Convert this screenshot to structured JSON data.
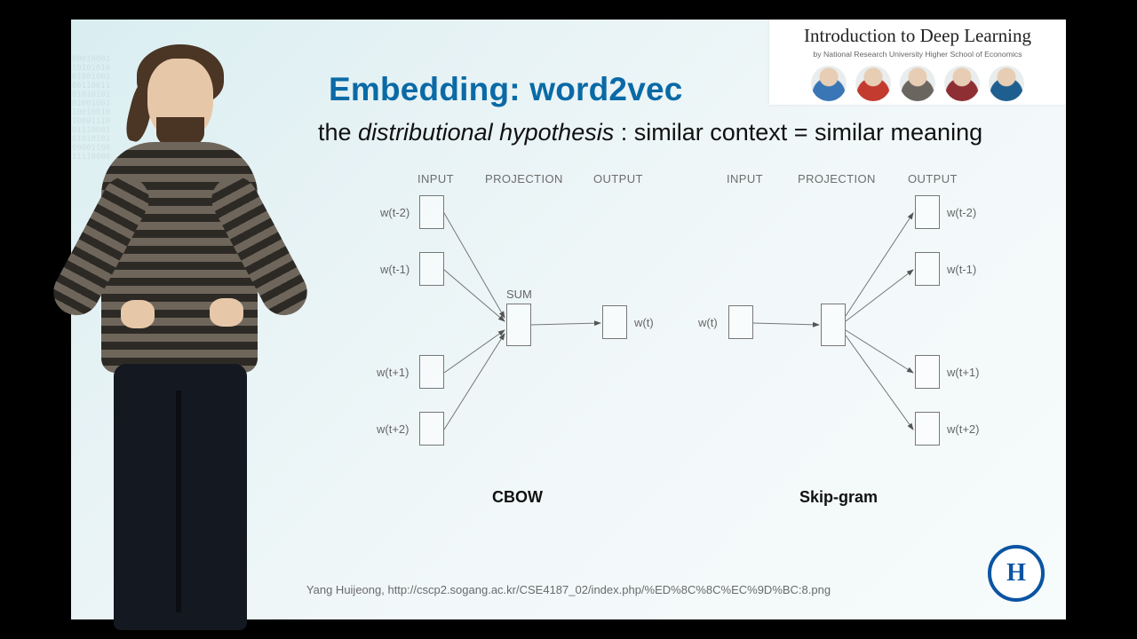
{
  "slide": {
    "title": "Embedding: word2vec",
    "subtitle_pre": "the ",
    "subtitle_em": "distributional hypothesis",
    "subtitle_post": " : similar context = similar meaning"
  },
  "course_card": {
    "title": "Introduction to Deep Learning",
    "subtitle": "by National Research University Higher School of Economics",
    "avatar_colors": [
      "#3a76b5",
      "#c33a2f",
      "#6b6560",
      "#8e2f33",
      "#1f5f8f"
    ]
  },
  "headers": {
    "input": "INPUT",
    "projection": "PROJECTION",
    "output": "OUTPUT"
  },
  "cbow": {
    "name": "CBOW",
    "sum_label": "SUM",
    "inputs": [
      "w(t-2)",
      "w(t-1)",
      "w(t+1)",
      "w(t+2)"
    ],
    "output": "w(t)"
  },
  "skipgram": {
    "name": "Skip-gram",
    "input": "w(t)",
    "outputs": [
      "w(t-2)",
      "w(t-1)",
      "w(t+1)",
      "w(t+2)"
    ]
  },
  "citation": "Yang Huijeong, http://cscp2.sogang.ac.kr/CSE4187_02/index.php/%ED%8C%8C%EC%9D%BC:8.png",
  "logo_text": "H"
}
